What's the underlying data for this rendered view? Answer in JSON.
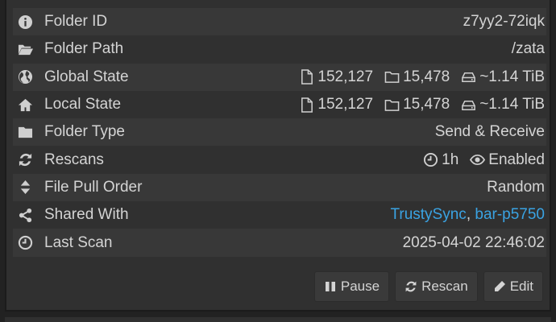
{
  "rows": [
    {
      "icon": "info-icon",
      "label": "Folder ID",
      "value": "z7yy2-72iqk"
    },
    {
      "icon": "folder-open-icon",
      "label": "Folder Path",
      "value": "/zata"
    },
    {
      "icon": "globe-icon",
      "label": "Global State",
      "files": "152,127",
      "folders": "15,478",
      "size": "~1.14 TiB"
    },
    {
      "icon": "home-icon",
      "label": "Local State",
      "files": "152,127",
      "folders": "15,478",
      "size": "~1.14 TiB"
    },
    {
      "icon": "folder-icon",
      "label": "Folder Type",
      "value": "Send & Receive"
    },
    {
      "icon": "refresh-icon",
      "label": "Rescans",
      "interval": "1h",
      "watcher": "Enabled"
    },
    {
      "icon": "sort-icon",
      "label": "File Pull Order",
      "value": "Random"
    },
    {
      "icon": "share-icon",
      "label": "Shared With",
      "devices": [
        "TrustySync",
        "bar-p5750"
      ],
      "separator": ", "
    },
    {
      "icon": "clock-icon",
      "label": "Last Scan",
      "value": "2025-04-02 22:46:02"
    }
  ],
  "buttons": {
    "pause": "Pause",
    "rescan": "Rescan",
    "edit": "Edit"
  },
  "colors": {
    "link": "#3aa3e3",
    "panel": "#303030",
    "row_stripe": "#383838",
    "background": "#222222"
  }
}
